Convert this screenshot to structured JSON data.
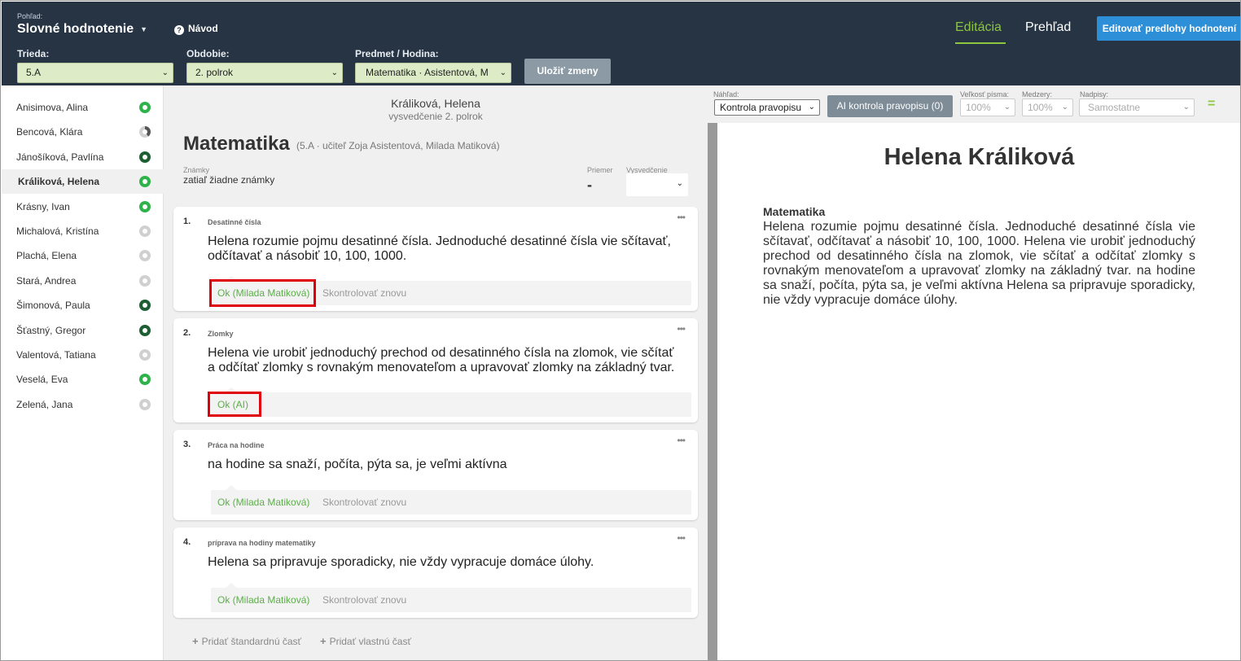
{
  "header": {
    "view_label": "Pohľad:",
    "view_title": "Slovné hodnotenie",
    "help_label": "Návod",
    "tab_edit": "Editácia",
    "tab_overview": "Prehľad",
    "edit_templates_button": "Editovať predlohy hodnotení",
    "class_label": "Trieda:",
    "class_value": "5.A",
    "period_label": "Obdobie:",
    "period_value": "2. polrok",
    "subject_label": "Predmet / Hodina:",
    "subject_value": "Matematika · Asistentová, M",
    "save_button": "Uložiť zmeny"
  },
  "students": [
    {
      "name": "Anisimova, Alina",
      "status": "green"
    },
    {
      "name": "Bencová, Klára",
      "status": "half"
    },
    {
      "name": "Jánošíková, Pavlína",
      "status": "dark"
    },
    {
      "name": "Králiková, Helena",
      "status": "green",
      "active": true
    },
    {
      "name": "Krásny, Ivan",
      "status": "green"
    },
    {
      "name": "Michalová, Kristína",
      "status": "grey"
    },
    {
      "name": "Plachá, Elena",
      "status": "grey"
    },
    {
      "name": "Stará, Andrea",
      "status": "grey"
    },
    {
      "name": "Šimonová, Paula",
      "status": "dark"
    },
    {
      "name": "Šťastný, Gregor",
      "status": "dark"
    },
    {
      "name": "Valentová, Tatiana",
      "status": "grey"
    },
    {
      "name": "Veselá, Eva",
      "status": "dark"
    },
    {
      "name": "Zelená, Jana",
      "status": "grey"
    }
  ],
  "student_status_colors": {
    "green": "#2db34a",
    "dark": "#1d5e33",
    "grey": "#d0d0d0"
  },
  "middle": {
    "student_name": "Králiková, Helena",
    "report_sub": "vysvedčenie 2. polrok",
    "subject": "Matematika",
    "subject_meta": "(5.A · učiteľ Zoja Asistentová, Milada Matiková)",
    "grades_label": "Známky",
    "grades_value": "zatiaľ žiadne známky",
    "average_label": "Priemer",
    "average_value": "-",
    "certificate_label": "Vysvedčenie",
    "add_standard": "Pridať štandardnú časť",
    "add_custom": "Pridať vlastnú časť"
  },
  "cards": [
    {
      "num": "1.",
      "title": "Desatinné čísla",
      "text": "Helena rozumie pojmu desatinné čísla. Jednoduché desatinné čísla vie sčítavať, odčítavať a násobiť 10, 100, 1000.",
      "ok": "Ok (Milada Matiková)",
      "recheck": "Skontrolovať znovu"
    },
    {
      "num": "2.",
      "title": "Zlomky",
      "text": "Helena vie urobiť jednoduchý prechod od desatinného čísla na zlomok, vie sčítať a odčítať zlomky s rovnakým menovateľom a upravovať zlomky na základný tvar.",
      "ok": "Ok (AI)",
      "recheck": ""
    },
    {
      "num": "3.",
      "title": "Práca na hodine",
      "text": "na hodine sa snaží, počíta, pýta sa, je veľmi aktívna",
      "ok": "Ok (Milada Matiková)",
      "recheck": "Skontrolovať znovu"
    },
    {
      "num": "4.",
      "title": "príprava na hodiny matematiky",
      "text": "Helena sa pripravuje sporadicky, nie vždy vypracuje domáce úlohy.",
      "ok": "Ok (Milada Matiková)",
      "recheck": "Skontrolovať znovu"
    }
  ],
  "toolbar": {
    "preview_label": "Náhľad:",
    "preview_value": "Kontrola pravopisu",
    "ai_check_button": "AI kontrola pravopisu (0)",
    "font_size_label": "Veľkosť písma:",
    "font_size_value": "100%",
    "spacing_label": "Medzery:",
    "spacing_value": "100%",
    "headings_label": "Nadpisy:",
    "headings_value": "Samostatne"
  },
  "preview": {
    "name": "Helena Králiková",
    "subject": "Matematika",
    "text": "Helena rozumie pojmu desatinné čísla. Jednoduché desatinné čísla vie sčítavať, odčítavať a násobiť 10, 100, 1000. Helena vie urobiť jednoduchý prechod od desatinného čísla na zlomok, vie sčítať a odčítať zlomky s rovnakým menovateľom a upravovať zlomky na základný tvar. na hodine sa snaží, počíta, pýta sa, je veľmi aktívna Helena sa pripravuje sporadicky, nie vždy vypracuje domáce úlohy."
  },
  "colors": {
    "accent_green": "#8cc63f",
    "header_bg": "#263444",
    "primary_blue": "#2e8fd9",
    "highlight_red": "#e0000b"
  }
}
